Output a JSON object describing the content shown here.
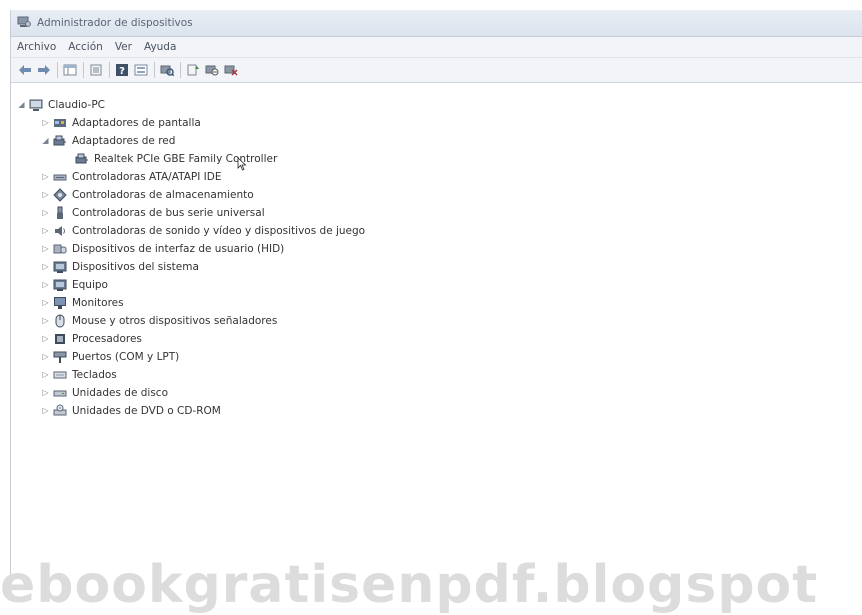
{
  "window": {
    "title": "Administrador de dispositivos"
  },
  "menu": [
    "Archivo",
    "Acción",
    "Ver",
    "Ayuda"
  ],
  "toolbar": {
    "buttons": [
      "back-icon",
      "forward-icon",
      "show-hide-tree-icon",
      "properties-icon",
      "help-icon",
      "view-icon",
      "scan-hardware-icon",
      "update-driver-icon",
      "disable-device-icon",
      "uninstall-icon"
    ]
  },
  "tree": {
    "root": "Claudio-PC",
    "items": [
      {
        "label": "Adaptadores de pantalla",
        "expanded": false,
        "icon": "display-adapter-icon"
      },
      {
        "label": "Adaptadores de red",
        "expanded": true,
        "icon": "network-adapter-icon",
        "children": [
          {
            "label": "Realtek PCIe GBE Family Controller",
            "icon": "network-card-icon"
          }
        ]
      },
      {
        "label": "Controladoras ATA/ATAPI IDE",
        "expanded": false,
        "icon": "ide-controller-icon"
      },
      {
        "label": "Controladoras de almacenamiento",
        "expanded": false,
        "icon": "storage-controller-icon"
      },
      {
        "label": "Controladoras de bus serie universal",
        "expanded": false,
        "icon": "usb-icon"
      },
      {
        "label": "Controladoras de sonido y vídeo y dispositivos de juego",
        "expanded": false,
        "icon": "sound-icon"
      },
      {
        "label": "Dispositivos de interfaz de usuario (HID)",
        "expanded": false,
        "icon": "hid-icon"
      },
      {
        "label": "Dispositivos del sistema",
        "expanded": false,
        "icon": "system-devices-icon"
      },
      {
        "label": "Equipo",
        "expanded": false,
        "icon": "computer-icon"
      },
      {
        "label": "Monitores",
        "expanded": false,
        "icon": "monitor-icon"
      },
      {
        "label": "Mouse y otros dispositivos señaladores",
        "expanded": false,
        "icon": "mouse-icon"
      },
      {
        "label": "Procesadores",
        "expanded": false,
        "icon": "processor-icon"
      },
      {
        "label": "Puertos (COM y LPT)",
        "expanded": false,
        "icon": "port-icon"
      },
      {
        "label": "Teclados",
        "expanded": false,
        "icon": "keyboard-icon"
      },
      {
        "label": "Unidades de disco",
        "expanded": false,
        "icon": "disk-drive-icon"
      },
      {
        "label": "Unidades de DVD o CD-ROM",
        "expanded": false,
        "icon": "dvd-drive-icon"
      }
    ]
  },
  "watermark": "ebookgratisenpdf.blogspot"
}
